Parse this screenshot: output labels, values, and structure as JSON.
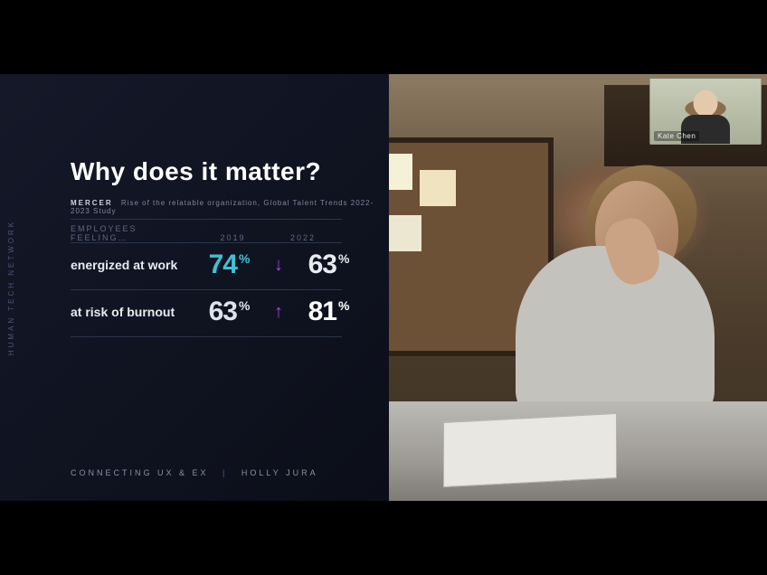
{
  "participant": {
    "name": "Kate Chen"
  },
  "slide": {
    "side_label": "HUMAN TECH NETWORK",
    "title": "Why does it matter?",
    "source_brand": "MERCER",
    "source_note": "Rise of the relatable organization, Global Talent Trends 2022-2023 Study",
    "columns": {
      "c0": "EMPLOYEES FEELING…",
      "c1": "2019",
      "c2": "2022"
    },
    "rows": [
      {
        "label": "energized at work",
        "y2019": "74",
        "dir": "↓",
        "y2022": "63"
      },
      {
        "label": "at risk of burnout",
        "y2019": "63",
        "dir": "↑",
        "y2022": "81"
      }
    ],
    "pct": "%",
    "footer": {
      "left": "CONNECTING UX & EX",
      "sep": "|",
      "right": "HOLLY JURA"
    }
  },
  "chart_data": {
    "type": "table",
    "title": "Why does it matter?",
    "columns": [
      "Employees feeling…",
      "2019",
      "2022"
    ],
    "rows": [
      {
        "metric": "energized at work",
        "2019": 74,
        "2022": 63,
        "direction": "down",
        "unit": "%"
      },
      {
        "metric": "at risk of burnout",
        "2019": 63,
        "2022": 81,
        "direction": "up",
        "unit": "%"
      }
    ],
    "source": "Mercer — Rise of the relatable organization, Global Talent Trends 2022-2023 Study"
  }
}
